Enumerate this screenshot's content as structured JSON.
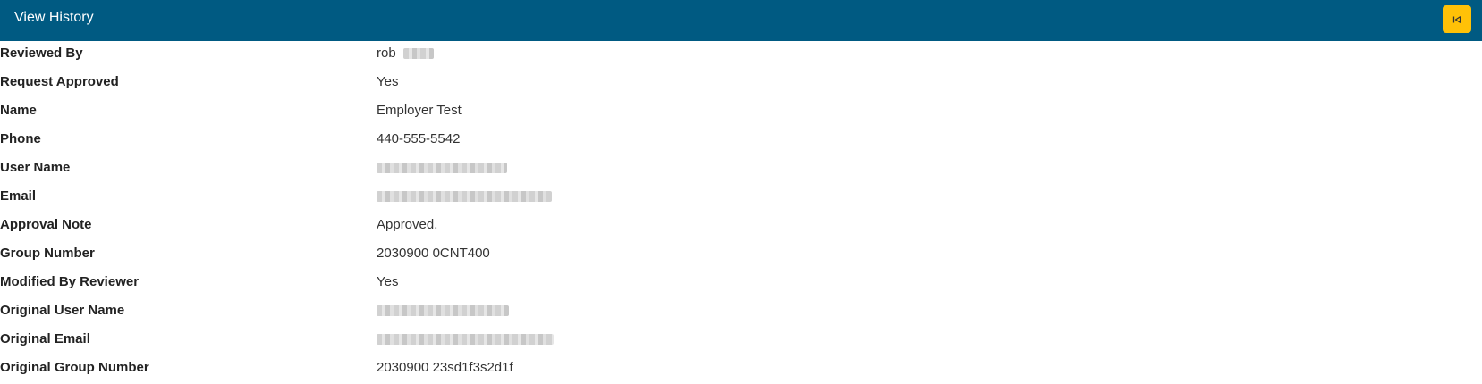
{
  "header": {
    "title": "View History",
    "back_icon": "collapse-left-icon",
    "background_color": "#005a82",
    "button_color": "#ffc107"
  },
  "details": [
    {
      "label": "Reviewed By",
      "value": "rob",
      "redacted": true
    },
    {
      "label": "Request Approved",
      "value": "Yes"
    },
    {
      "label": "Name",
      "value": "Employer Test"
    },
    {
      "label": "Phone",
      "value": "440-555-5542"
    },
    {
      "label": "User Name",
      "value": "",
      "redacted": true
    },
    {
      "label": "Email",
      "value": "",
      "redacted": true
    },
    {
      "label": "Approval Note",
      "value": "Approved."
    },
    {
      "label": "Group Number",
      "value": "2030900 0CNT400"
    },
    {
      "label": "Modified By Reviewer",
      "value": "Yes"
    },
    {
      "label": "Original User Name",
      "value": "",
      "redacted": true
    },
    {
      "label": "Original Email",
      "value": "",
      "redacted": true
    },
    {
      "label": "Original Group Number",
      "value": "2030900 23sd1f3s2d1f"
    }
  ]
}
